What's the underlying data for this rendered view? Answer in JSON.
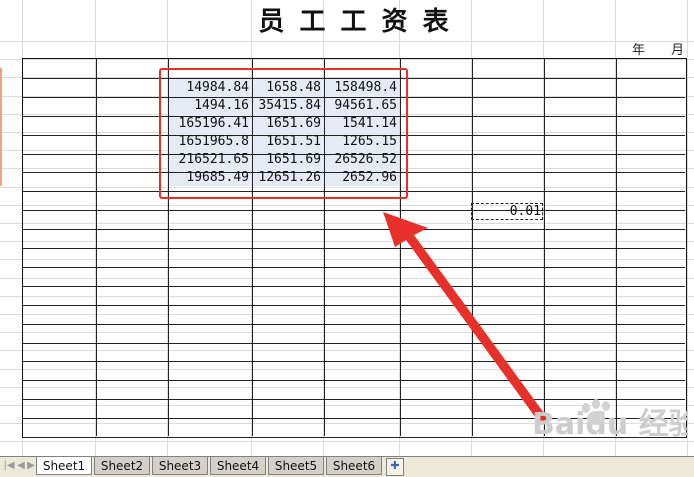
{
  "title": "员 工 工 资 表",
  "date_labels": {
    "year": "年",
    "month": "月"
  },
  "selected_range": {
    "rows": [
      [
        "14984.84",
        "1658.48",
        "158498.4"
      ],
      [
        "1494.16",
        "35415.84",
        "94561.65"
      ],
      [
        "165196.41",
        "1651.69",
        "1541.14"
      ],
      [
        "1651965.8",
        "1651.51",
        "1265.15"
      ],
      [
        "216521.65",
        "1651.69",
        "26526.52"
      ],
      [
        "19685.49",
        "12651.26",
        "2652.96"
      ]
    ]
  },
  "copied_cell": {
    "value": "0.01"
  },
  "sheet_tabs": [
    "Sheet1",
    "Sheet2",
    "Sheet3",
    "Sheet4",
    "Sheet5",
    "Sheet6"
  ],
  "active_tab": "Sheet1",
  "nav_icons": [
    "first-sheet-icon",
    "prev-sheet-icon",
    "next-sheet-icon",
    "last-sheet-icon"
  ],
  "new_sheet_icon": "new-sheet-icon",
  "annotation": {
    "color": "#e8302a",
    "shape": "rectangle-and-arrow"
  },
  "watermark": {
    "text": "Baidu 经验"
  }
}
